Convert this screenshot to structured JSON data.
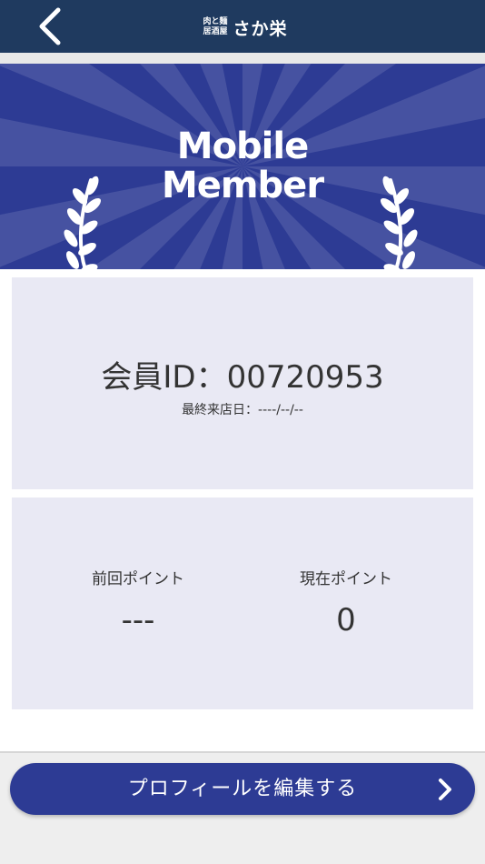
{
  "header": {
    "back_icon": "chevron-left-icon",
    "logo": {
      "line1": "肉と麺",
      "line2": "居酒屋",
      "name": "さか栄"
    }
  },
  "banner": {
    "title_line1": "Mobile",
    "title_line2": "Member",
    "decoration_icon": "laurel-icon",
    "bg_color": "#2d3b94"
  },
  "member": {
    "id_text": "会員ID：00720953",
    "last_visit": "最終来店日：----/--/--"
  },
  "points": {
    "previous_label": "前回ポイント",
    "previous_value": "---",
    "current_label": "現在ポイント",
    "current_value": "0"
  },
  "footer": {
    "edit_profile_label": "プロフィールを編集する",
    "edit_icon": "chevron-right-icon",
    "button_color": "#2d3b94"
  },
  "colors": {
    "header": "#1f3a5f",
    "card": "#e9e9f4",
    "text": "#333333"
  }
}
